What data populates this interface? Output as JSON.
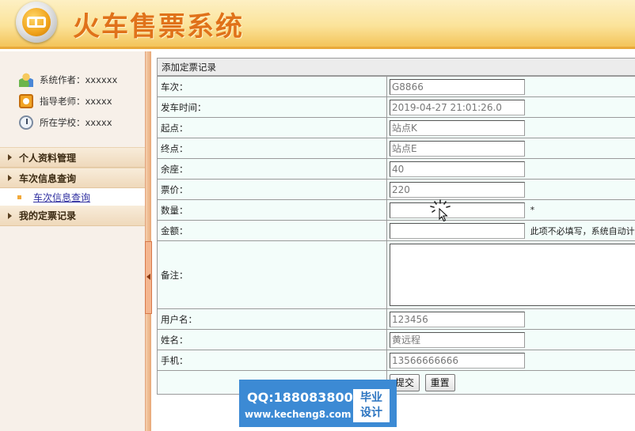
{
  "header": {
    "title": "火车售票系统"
  },
  "sidebar": {
    "info": [
      {
        "icon": "users-icon",
        "text": "系统作者：xxxxxx"
      },
      {
        "icon": "teacher-icon",
        "text": "指导老师：xxxxx"
      },
      {
        "icon": "clock-icon",
        "text": "所在学校：xxxxx"
      }
    ],
    "menu": {
      "profile": "个人资料管理",
      "train_query": "车次信息查询",
      "train_query_sub": "车次信息查询",
      "my_orders": "我的定票记录"
    }
  },
  "form": {
    "title": "添加定票记录",
    "train_no": {
      "label": "车次：",
      "value": "G8866"
    },
    "depart_time": {
      "label": "发车时间：",
      "value": "2019-04-27 21:01:26.0"
    },
    "origin": {
      "label": "起点：",
      "value": "站点K"
    },
    "destination": {
      "label": "终点：",
      "value": "站点E"
    },
    "seats_left": {
      "label": "余座：",
      "value": "40"
    },
    "price": {
      "label": "票价：",
      "value": "220"
    },
    "quantity": {
      "label": "数量：",
      "value": "",
      "required_mark": "*"
    },
    "amount": {
      "label": "金额：",
      "value": "",
      "note": "此项不必填写，系统自动计"
    },
    "remark": {
      "label": "备注：",
      "value": ""
    },
    "username": {
      "label": "用户名：",
      "value": "123456"
    },
    "name": {
      "label": "姓名：",
      "value": "黄远程"
    },
    "phone": {
      "label": "手机：",
      "value": "13566666666"
    },
    "submit_label": "提交",
    "reset_label": "重置"
  },
  "watermark": {
    "qq": "QQ:188083800",
    "url": "www.kecheng8.com",
    "tag_line1": "毕业",
    "tag_line2": "设计"
  }
}
